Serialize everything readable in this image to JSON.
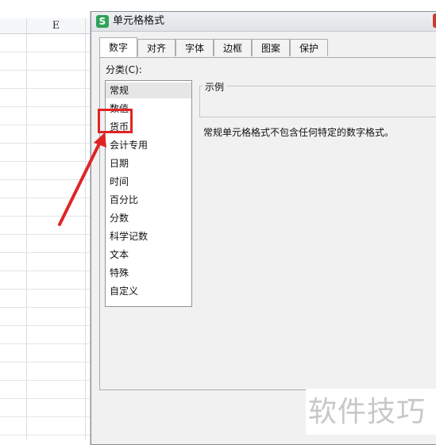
{
  "sheet": {
    "column_label": "E"
  },
  "dialog": {
    "title": "单元格格式",
    "logo_letter": "S",
    "tabs": [
      {
        "label": "数字",
        "active": true
      },
      {
        "label": "对齐",
        "active": false
      },
      {
        "label": "字体",
        "active": false
      },
      {
        "label": "边框",
        "active": false
      },
      {
        "label": "图案",
        "active": false
      },
      {
        "label": "保护",
        "active": false
      }
    ],
    "category_label": "分类(C):",
    "categories": [
      {
        "label": "常规",
        "selected": true
      },
      {
        "label": "数值",
        "selected": false
      },
      {
        "label": "货币",
        "selected": false
      },
      {
        "label": "会计专用",
        "selected": false
      },
      {
        "label": "日期",
        "selected": false
      },
      {
        "label": "时间",
        "selected": false
      },
      {
        "label": "百分比",
        "selected": false
      },
      {
        "label": "分数",
        "selected": false
      },
      {
        "label": "科学记数",
        "selected": false
      },
      {
        "label": "文本",
        "selected": false
      },
      {
        "label": "特殊",
        "selected": false
      },
      {
        "label": "自定义",
        "selected": false
      }
    ],
    "sample_label": "示例",
    "description": "常规单元格格式不包含任何特定的数字格式。"
  },
  "annotation": {
    "color": "#e02424"
  },
  "watermark": "软件技巧"
}
